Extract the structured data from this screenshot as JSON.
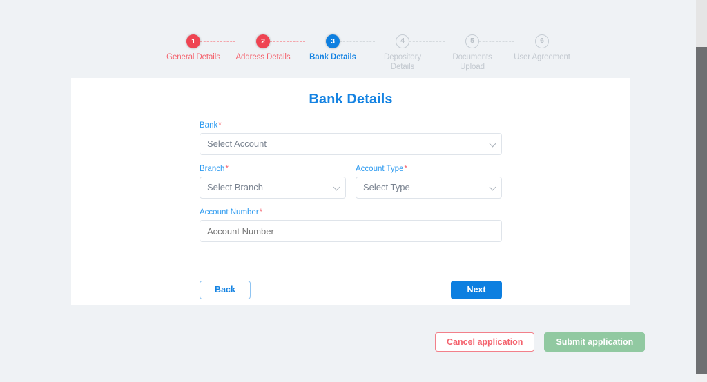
{
  "stepper": {
    "steps": [
      {
        "number": "1",
        "label": "General Details",
        "state": "done"
      },
      {
        "number": "2",
        "label": "Address Details",
        "state": "done"
      },
      {
        "number": "3",
        "label": "Bank Details",
        "state": "active"
      },
      {
        "number": "4",
        "label": "Depository Details",
        "state": "todo"
      },
      {
        "number": "5",
        "label": "Documents Upload",
        "state": "todo"
      },
      {
        "number": "6",
        "label": "User Agreement",
        "state": "todo"
      }
    ]
  },
  "card": {
    "title": "Bank Details",
    "fields": {
      "bank": {
        "label": "Bank",
        "required": "*",
        "value": "Select Account",
        "icon": "chevron-down-icon"
      },
      "branch": {
        "label": "Branch",
        "required": "*",
        "value": "Select Branch",
        "icon": "chevron-down-icon"
      },
      "account_type": {
        "label": "Account Type",
        "required": "*",
        "value": "Select Type",
        "icon": "chevron-down-icon"
      },
      "account_number": {
        "label": "Account Number",
        "required": "*",
        "value": "",
        "placeholder": "Account Number"
      }
    },
    "nav": {
      "back_label": "Back",
      "next_label": "Next"
    }
  },
  "actions": {
    "cancel_label": "Cancel application",
    "submit_label": "Submit application"
  },
  "colors": {
    "page_background": "#eff2f5",
    "card_background": "#ffffff",
    "accent_blue": "#1583e2",
    "active_step": "#0d7fe0",
    "done_step": "#ef4452",
    "required_red": "#f4626d",
    "label_blue": "#2e9bf0",
    "muted_gray": "#c3c9d0",
    "submit_green": "#8cc79d",
    "scrollbar_thumb": "#6e7072"
  }
}
